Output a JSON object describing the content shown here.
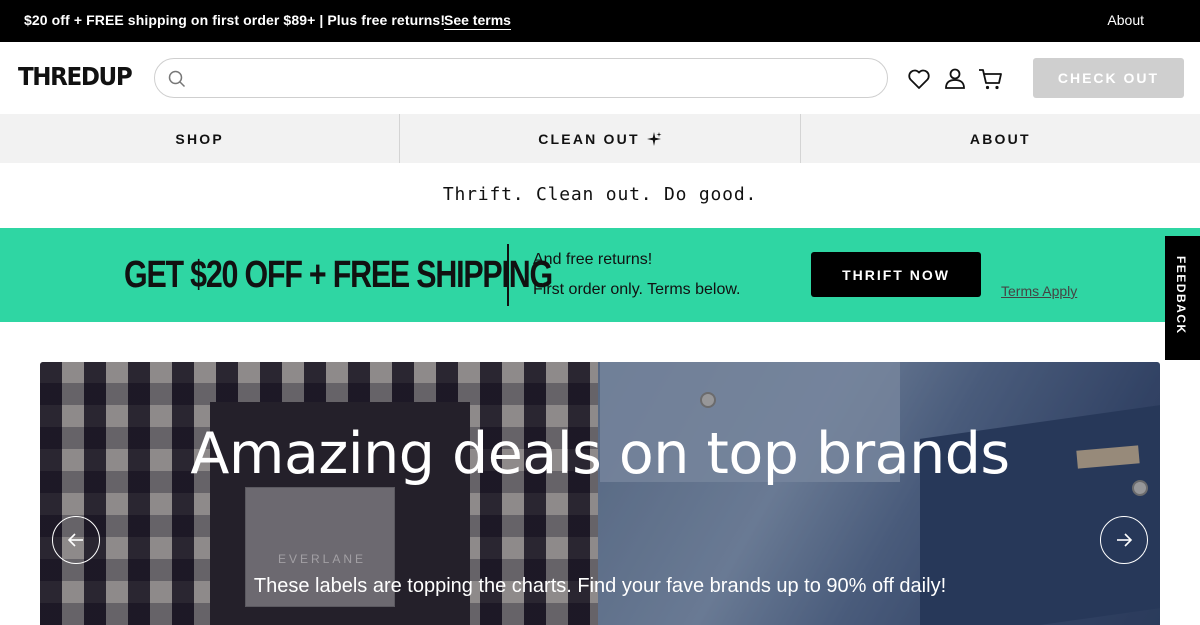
{
  "promo": {
    "text": "$20 off + FREE shipping on first order $89+ | Plus free returns!",
    "link": "See terms",
    "about": "About"
  },
  "header": {
    "logo": "THREDUP",
    "search_placeholder": "",
    "checkout_label": "CHECK OUT"
  },
  "nav": {
    "items": [
      {
        "label": "SHOP"
      },
      {
        "label": "CLEAN OUT",
        "icon": "sparkle-icon"
      },
      {
        "label": "ABOUT"
      }
    ]
  },
  "tagline": "Thrift. Clean out. Do good.",
  "banner": {
    "headline": "GET $20 OFF + FREE SHIPPING",
    "line1": "And free returns!",
    "line2": "First order only. Terms below.",
    "cta": "THRIFT NOW",
    "terms": "Terms Apply",
    "bg_color": "#2fd6a3"
  },
  "feedback": "FEEDBACK",
  "hero": {
    "title": "Amazing deals on top brands",
    "subtitle": "These labels are topping the charts. Find your fave brands up to 90% off daily!",
    "image_label_text": "EVERLANE"
  }
}
